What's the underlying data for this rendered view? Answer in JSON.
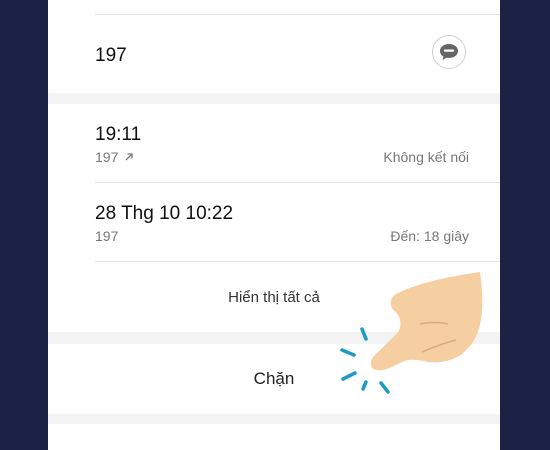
{
  "contact": {
    "number": "197"
  },
  "icons": {
    "message": "message-bubble-icon",
    "outgoing_call": "call-made-arrow-icon"
  },
  "calls": [
    {
      "time": "19:11",
      "number": "197",
      "status": "Không kết nối",
      "direction": "outgoing"
    },
    {
      "time": "28 Thg 10 10:22",
      "number": "197",
      "status": "Đến: 18 giây",
      "direction": "incoming"
    }
  ],
  "actions": {
    "show_all_label": "Hiển thị tất cả",
    "block_label": "Chặn"
  },
  "colors": {
    "background": "#1c2146",
    "tap_accent": "#1e9bc3",
    "hand_skin": "#f5cfa2"
  }
}
